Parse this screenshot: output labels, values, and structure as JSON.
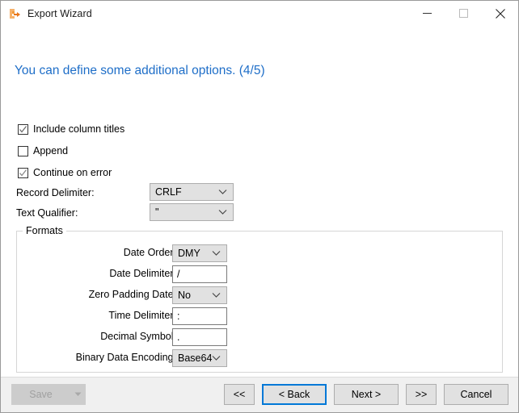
{
  "window": {
    "title": "Export Wizard",
    "icon": "export-wizard-icon",
    "controls": {
      "minimize": "minimize-icon",
      "maximize": "maximize-icon",
      "close": "close-icon"
    }
  },
  "heading": {
    "text": "You can define some additional options. (4/5)",
    "color": "#1e6ec8"
  },
  "checkboxes": [
    {
      "label": "Include column titles",
      "checked": true
    },
    {
      "label": "Append",
      "checked": false
    },
    {
      "label": "Continue on error",
      "checked": true
    }
  ],
  "delimiters": [
    {
      "label": "Record Delimiter:",
      "value": "CRLF",
      "type": "combo"
    },
    {
      "label": "Text Qualifier:",
      "value": "\"",
      "type": "combo"
    }
  ],
  "formats": {
    "caption": "Formats",
    "fields": [
      {
        "label": "Date Order:",
        "value": "DMY",
        "type": "combo"
      },
      {
        "label": "Date Delimiter:",
        "value": "/",
        "type": "textbox"
      },
      {
        "label": "Zero Padding Date:",
        "value": "No",
        "type": "combo"
      },
      {
        "label": "Time Delimiter:",
        "value": ":",
        "type": "textbox"
      },
      {
        "label": "Decimal Symbol:",
        "value": ".",
        "type": "textbox"
      },
      {
        "label": "Binary Data Encoding:",
        "value": "Base64",
        "type": "combo"
      }
    ]
  },
  "footer": {
    "save": {
      "label": "Save",
      "enabled": false
    },
    "nav": [
      {
        "label": "<<",
        "name": "first-button",
        "focused": false
      },
      {
        "label": "< Back",
        "name": "back-button",
        "focused": true
      },
      {
        "label": "Next >",
        "name": "next-button",
        "focused": false
      },
      {
        "label": ">>",
        "name": "last-button",
        "focused": false
      },
      {
        "label": "Cancel",
        "name": "cancel-button",
        "focused": false
      }
    ]
  },
  "colors": {
    "accent": "#0078d7",
    "heading": "#1e6ec8",
    "control_face": "#e1e1e1",
    "footer_bg": "#f0f0f0"
  }
}
